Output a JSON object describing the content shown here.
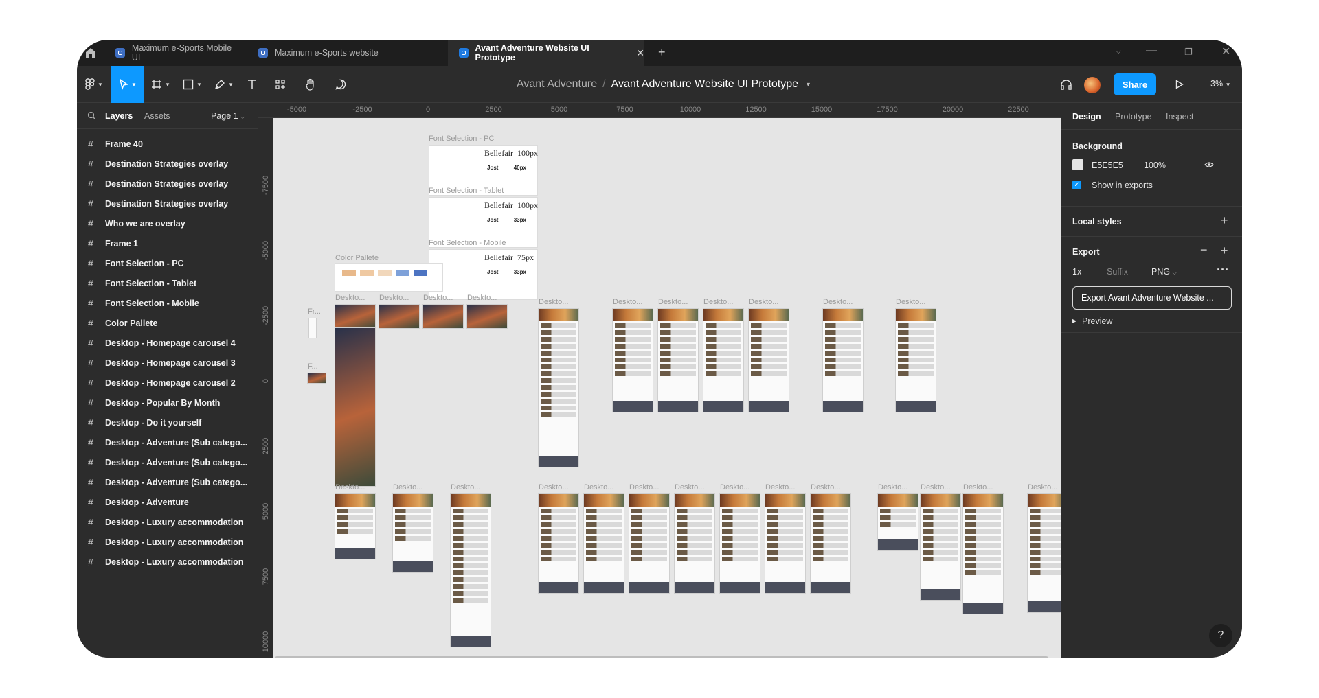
{
  "tabs": [
    {
      "label": "Maximum e-Sports Mobile UI"
    },
    {
      "label": "Maximum e-Sports website"
    },
    {
      "label": "Avant Adventure Website UI Prototype"
    }
  ],
  "toolbar": {
    "project": "Avant Adventure",
    "file": "Avant Adventure Website UI Prototype",
    "share_label": "Share",
    "zoom": "3%"
  },
  "left_panel": {
    "tab_layers": "Layers",
    "tab_assets": "Assets",
    "page": "Page 1",
    "layers": [
      "Frame 40",
      "Destination Strategies overlay",
      "Destination Strategies overlay",
      "Destination Strategies overlay",
      "Who we are overlay",
      "Frame 1",
      "Font Selection - PC",
      "Font Selection - Tablet",
      "Font Selection - Mobile",
      "Color Pallete",
      "Desktop - Homepage carousel 4",
      "Desktop - Homepage carousel 3",
      "Desktop - Homepage carousel 2",
      "Desktop - Popular By Month",
      "Desktop - Do it yourself",
      "Desktop - Adventure (Sub catego...",
      "Desktop - Adventure (Sub catego...",
      "Desktop - Adventure (Sub catego...",
      "Desktop - Adventure",
      "Desktop - Luxury accommodation",
      "Desktop - Luxury accommodation",
      "Desktop - Luxury accommodation"
    ]
  },
  "rulers": {
    "top": [
      "-5000",
      "-2500",
      "0",
      "2500",
      "5000",
      "7500",
      "10000",
      "12500",
      "15000",
      "17500",
      "20000",
      "22500"
    ],
    "left": [
      "-7500",
      "-5000",
      "-2500",
      "0",
      "2500",
      "5000",
      "7500",
      "10000"
    ]
  },
  "canvas": {
    "font_pc_label": "Font Selection - PC",
    "font_tablet_label": "Font Selection - Tablet",
    "font_mobile_label": "Font Selection - Mobile",
    "palette_label": "Color Pallete",
    "font_pc": {
      "name": "Bellefair",
      "size": "100px",
      "name2": "Jost",
      "size2": "40px"
    },
    "font_tablet": {
      "name": "Bellefair",
      "size": "100px",
      "name2": "Jost",
      "size2": "33px"
    },
    "font_mobile": {
      "name": "Bellefair",
      "size": "75px",
      "name2": "Jost",
      "size2": "33px"
    },
    "frame_label": "Deskto...",
    "frame_label_short": "Fr...",
    "frame_label_f": "F...",
    "palette_colors": [
      "#e8b98b",
      "#efc9a2",
      "#f1d7bb",
      "#7ea1d9",
      "#4d74c2"
    ]
  },
  "right_panel": {
    "tab_design": "Design",
    "tab_prototype": "Prototype",
    "tab_inspect": "Inspect",
    "background_title": "Background",
    "background_hex": "E5E5E5",
    "background_opacity": "100%",
    "show_in_exports": "Show in exports",
    "local_styles": "Local styles",
    "export_title": "Export",
    "export_scale": "1x",
    "export_suffix": "Suffix",
    "export_format": "PNG",
    "export_button": "Export Avant Adventure Website ...",
    "preview": "Preview"
  }
}
